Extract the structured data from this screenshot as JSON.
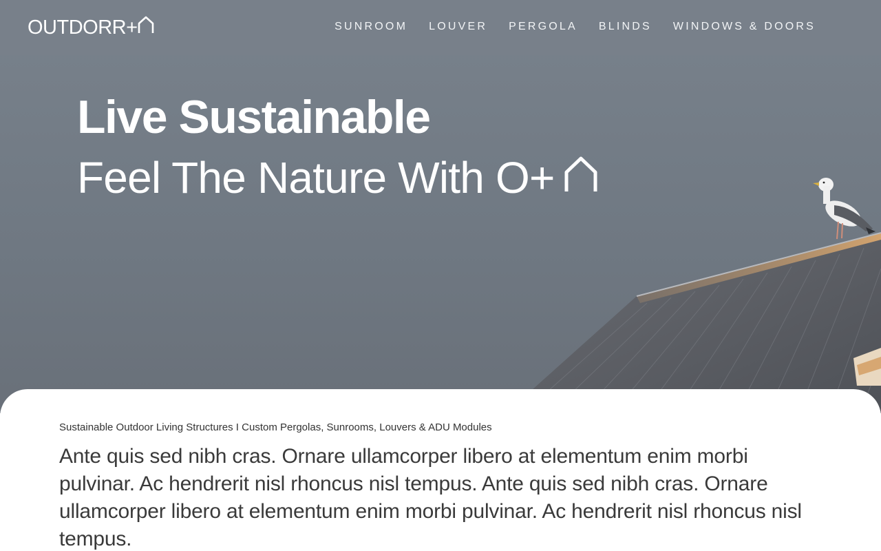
{
  "brand": {
    "logo_text": "OUTDORR+",
    "logo_icon": "house-outline-icon"
  },
  "nav": {
    "items": [
      {
        "label": "SUNROOM"
      },
      {
        "label": "LOUVER"
      },
      {
        "label": "PERGOLA"
      },
      {
        "label": "BLINDS"
      },
      {
        "label": "WINDOWS & DOORS"
      }
    ]
  },
  "hero": {
    "title": "Live Sustainable",
    "subtitle": "Feel The Nature With O+",
    "subtitle_icon": "house-outline-icon",
    "background": "photo: dusk sky with corrugated metal roof and a seagull perched on the ridge"
  },
  "content": {
    "tagline": "Sustainable Outdoor Living Structures I Custom Pergolas, Sunrooms, Louvers & ADU Modules",
    "body": "Ante quis sed nibh cras. Ornare ullamcorper libero at elementum enim morbi pulvinar. Ac hendrerit nisl rhoncus nisl tempus. Ante quis sed nibh cras. Ornare ullamcorper libero at elementum enim morbi pulvinar. Ac hendrerit nisl rhoncus nisl tempus."
  },
  "colors": {
    "nav_bg": "#78808a",
    "hero_sky": "#747d87",
    "roof": "#5a5d63",
    "roof_highlight": "#d9a86b",
    "text_dark": "#333333",
    "white": "#ffffff"
  }
}
